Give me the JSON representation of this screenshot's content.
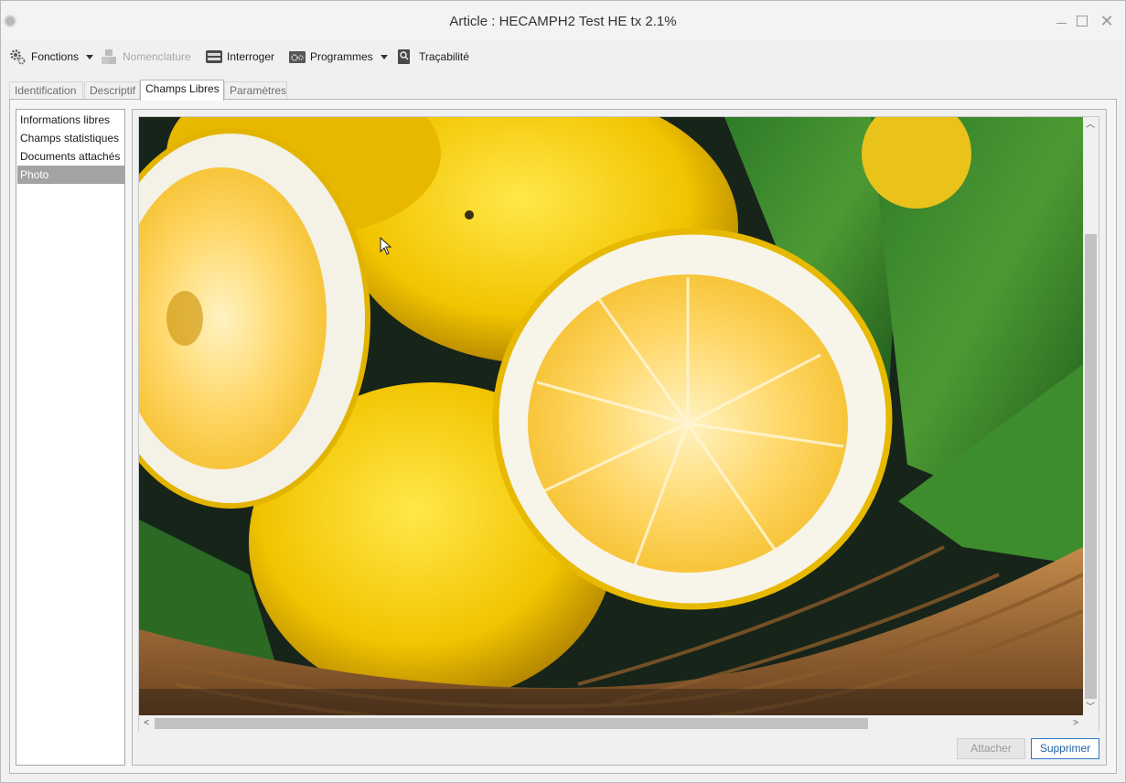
{
  "window": {
    "title": "Article : HECAMPH2 Test HE tx 2.1%"
  },
  "toolbar": {
    "items": [
      {
        "label": "Fonctions",
        "icon": "gears-icon",
        "dropdown": true,
        "enabled": true
      },
      {
        "label": "Nomenclature",
        "icon": "blocks-icon",
        "dropdown": false,
        "enabled": false
      },
      {
        "label": "Interroger",
        "icon": "database-icon",
        "dropdown": false,
        "enabled": true
      },
      {
        "label": "Programmes",
        "icon": "program-icon",
        "dropdown": true,
        "enabled": true
      },
      {
        "label": "Traçabilité",
        "icon": "trace-search-icon",
        "dropdown": false,
        "enabled": true
      }
    ]
  },
  "tabs": [
    {
      "label": "Identification",
      "active": false
    },
    {
      "label": "Descriptif",
      "active": false
    },
    {
      "label": "Champs Libres",
      "active": true
    },
    {
      "label": "Paramètres",
      "active": false
    }
  ],
  "sidebar": {
    "items": [
      {
        "label": "Informations libres",
        "selected": false
      },
      {
        "label": "Champs statistiques",
        "selected": false
      },
      {
        "label": "Documents attachés",
        "selected": false
      },
      {
        "label": "Photo",
        "selected": true
      }
    ]
  },
  "photo": {
    "subject": "lemons-in-basket"
  },
  "actions": {
    "attach_label": "Attacher",
    "attach_enabled": false,
    "delete_label": "Supprimer"
  },
  "colors": {
    "selected_item": "#a3a3a3",
    "primary_button_border": "#2a78c7"
  }
}
